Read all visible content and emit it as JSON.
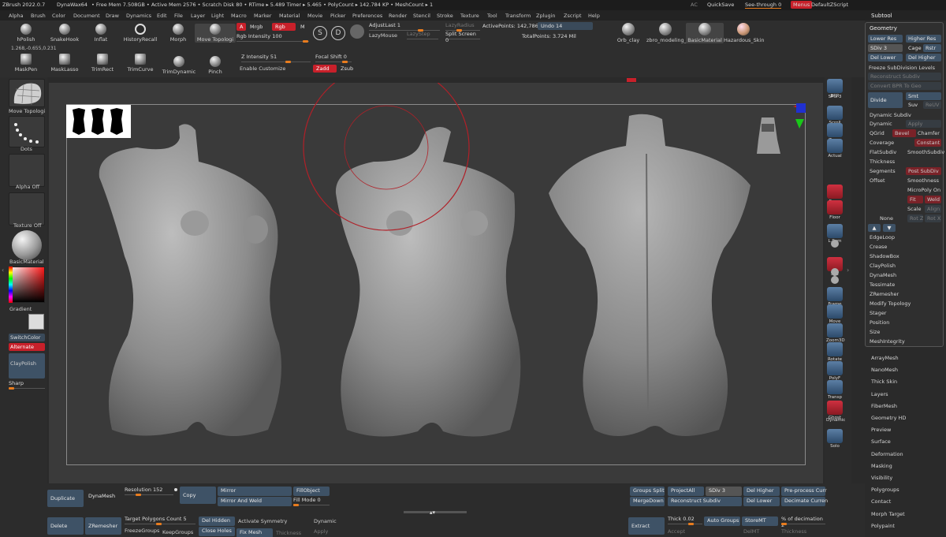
{
  "titlebar": {
    "app": "ZBrush 2022.0.7",
    "doc": "DynaWax64",
    "mem": "• Free Mem 7.508GB • Active Mem 2576 • Scratch Disk 80 • RTime ▸ 5.489 Timer ▸ 5.465 • PolyCount ▸ 142.784 KP • MeshCount ▸ 1",
    "ac": "AC",
    "quicksave": "QuickSave",
    "see_through": "See-through",
    "see_through_value": "0",
    "menus": "Menus",
    "script": "DefaultZScript"
  },
  "menubar": [
    "Alpha",
    "Brush",
    "Color",
    "Document",
    "Draw",
    "Dynamics",
    "Edit",
    "File",
    "Layer",
    "Light",
    "Macro",
    "Marker",
    "Material",
    "Movie",
    "Picker",
    "Preferences",
    "Render",
    "Stencil",
    "Stroke",
    "Texture",
    "Tool",
    "Transform",
    "Zplugin",
    "Zscript",
    "Help"
  ],
  "subtool_tab": "Subtool",
  "toptools": {
    "brushes": [
      "hPolish",
      "SnakeHook",
      "Inflat",
      "HistoryRecall",
      "Morph",
      "Move Topologi"
    ],
    "brushes2": [
      "MaskPen",
      "MaskLasso",
      "TrimRect",
      "TrimCurve",
      "TrimDynamic",
      "Pinch"
    ],
    "a": "A",
    "mrgb": "Mrgb",
    "rgb": "Rgb",
    "m": "M",
    "rgb_intensity": "Rgb Intensity 100",
    "z_intensity": "Z Intensity 51",
    "focal_shift": "Focal Shift 0",
    "enable_customize": "Enable Customize",
    "zadd": "Zadd",
    "zsub": "Zsub",
    "adjust_last": "AdjustLast 1",
    "lazy_radius": "LazyRadius",
    "lazy_mouse": "LazyMouse",
    "lazy_step": "LazyStep",
    "split_screen": "Split Screen",
    "split_screen_value": "0",
    "active_points": "ActivePoints: 142,786",
    "total_points": "TotalPoints: 3.724 Mil",
    "undo": "Undo 14",
    "coords": "1.268,-0.655,0.231",
    "materials": [
      "Orb_clay",
      "zbro_modeling_",
      "BasicMaterial",
      "Hazardous_Skin"
    ]
  },
  "leftshelf": {
    "move_topologi": "Move Topologi",
    "dots": "Dots",
    "alpha_off": "Alpha Off",
    "texture_off": "Texture Off",
    "basic_material": "BasicMaterial",
    "gradient": "Gradient",
    "switch_color": "SwitchColor",
    "alternate": "Alternate",
    "clay_polish": "ClayPolish",
    "sharp": "Sharp"
  },
  "rightshelf": [
    "BPR",
    "SPix 3",
    "Scroll",
    "Zoom",
    "Actual",
    "Persp",
    "Floor",
    "L.Sym",
    "",
    "Xyz",
    "",
    "",
    "Frame",
    "Move",
    "Zoom3D",
    "Rotate",
    "PolyF",
    "Transp",
    "Ghost",
    "Dynamic",
    "Solo"
  ],
  "subtool_panel": {
    "geometry": "Geometry",
    "lower_res": "Lower Res",
    "higher_res": "Higher Res",
    "sdiv": "SDiv 3",
    "cage": "Cage",
    "rstr": "Rstr",
    "del_lower": "Del Lower",
    "del_higher": "Del Higher",
    "freeze": "Freeze SubDivision Levels",
    "reconstruct": "Reconstruct Subdiv",
    "convert_bpr": "Convert BPR To Geo",
    "divide": "Divide",
    "smt": "Smt",
    "suv": "Suv",
    "reuv": "ReUV",
    "dynamic_subdiv": "Dynamic Subdiv",
    "dynamic": "Dynamic",
    "apply": "Apply",
    "qgrid": "QGrid",
    "bevel": "Bevel",
    "chamfer": "Chamfer",
    "coverage": "Coverage",
    "constant": "Constant",
    "flat_subdiv": "FlatSubdiv",
    "smooth_subdiv": "SmoothSubdiv",
    "thickness": "Thickness",
    "segments": "Segments",
    "post_subdiv": "Post SubDiv",
    "offset": "Offset",
    "smoothness": "Smoothness",
    "micropoly": "MicroPoly On",
    "fit": "Fit",
    "weld": "Weld",
    "scale": "Scale",
    "align": "Align",
    "none": "None",
    "rot_z": "Rot Z",
    "rot_x": "Rot X",
    "list": [
      "EdgeLoop",
      "Crease",
      "ShadowBox",
      "ClayPolish",
      "DynaMesh",
      "Tessimate",
      "ZRemesher",
      "Modify Topology",
      "Stager",
      "Position",
      "Size",
      "MeshIntegrity"
    ]
  },
  "rightlist": [
    "ArrayMesh",
    "NanoMesh",
    "Thick Skin",
    "Layers",
    "FiberMesh",
    "Geometry HD",
    "Preview",
    "Surface",
    "Deformation",
    "Masking",
    "Visibility",
    "Polygroups",
    "Contact",
    "Morph Target",
    "Polypaint"
  ],
  "bottom": {
    "duplicate": "Duplicate",
    "dynamesh": "DynaMesh",
    "resolution": "Resolution 152",
    "copy": "Copy",
    "mirror": "Mirror",
    "mirror_weld": "Mirror And Weld",
    "fill_object": "FillObject",
    "fill_mode": "Fill Mode 0",
    "delete": "Delete",
    "zremesher": "ZRemesher",
    "target_polygons": "Target Polygons Count 5",
    "freeze_groups": "FreezeGroups",
    "keep_groups": "KeepGroups",
    "del_hidden": "Del Hidden",
    "close_holes": "Close Holes",
    "activate_symmetry": "Activate Symmetry",
    "fix_mesh": "Fix Mesh",
    "thickness": "Thickness",
    "dynamic": "Dynamic",
    "apply": "Apply",
    "groups_split": "Groups Split",
    "project_all": "ProjectAll",
    "sdiv": "SDiv 3",
    "del_higher": "Del Higher",
    "preprocess": "Pre-process Curr",
    "merge_down": "MergeDown",
    "reconstruct": "Reconstruct Subdiv",
    "del_lower": "Del Lower",
    "decimate": "Decimate Curren",
    "extract": "Extract",
    "thick": "Thick 0.02",
    "auto_groups": "Auto Groups",
    "store_mt": "StoreMT",
    "pct_decimation": "% of decimation 2",
    "accept": "Accept",
    "delmt": "DelMT",
    "thickness2": "Thickness"
  },
  "colors": {
    "accent": "#e87c1e",
    "red": "#c8202a",
    "button": "#3e5266"
  }
}
